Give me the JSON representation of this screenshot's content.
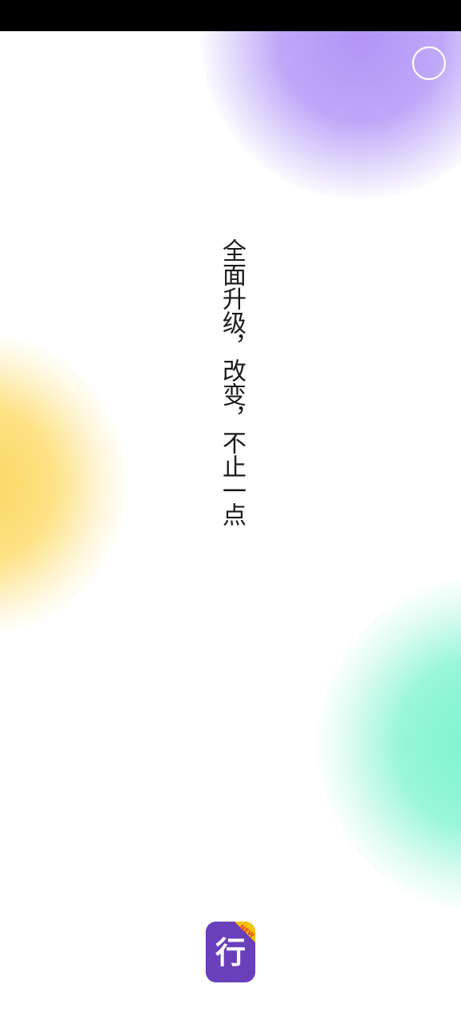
{
  "slogan": "全面升级，改变，不止一点",
  "logo": {
    "glyph": "行",
    "badge": "NEW",
    "icon": "app-logo-icon"
  },
  "skip_control": {
    "icon": "skip-countdown-ring-icon"
  },
  "colors": {
    "status_bar": "#000000",
    "background": "#ffffff",
    "logo_bg": "#6a3fbb",
    "logo_badge": "#f5c400",
    "blob_purple": "#b092f6",
    "blob_yellow": "#fcd45a",
    "blob_green": "#76f2ce"
  }
}
